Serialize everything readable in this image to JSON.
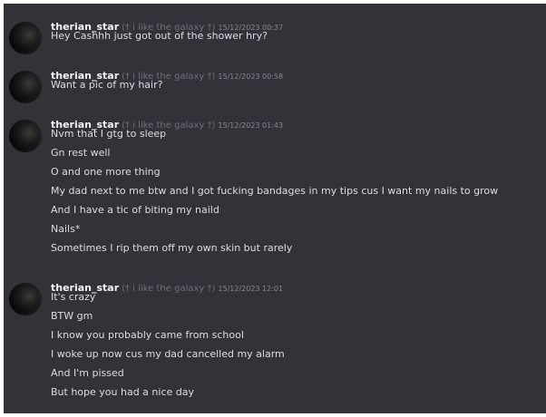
{
  "groups": [
    {
      "author": "therian_star",
      "tag": "(† i like the galaxy †)",
      "timestamp": "15/12/2023 00:37",
      "lines": [
        "Hey Cashhh just got out  of the shower hry?"
      ]
    },
    {
      "author": "therian_star",
      "tag": "(† i like the galaxy †)",
      "timestamp": "15/12/2023 00:58",
      "lines": [
        "Want a pic of my hair?"
      ]
    },
    {
      "author": "therian_star",
      "tag": "(† i like the galaxy †)",
      "timestamp": "15/12/2023 01:43",
      "lines": [
        "Nvm that I gtg to sleep",
        "Gn rest well",
        "O and one more thing",
        "My dad next to me btw and I got fucking bandages in my tips cus I want my nails to grow",
        "And I have a tic of biting my naild",
        "Nails*",
        "Sometimes I rip them off my own skin but rarely"
      ]
    },
    {
      "author": "therian_star",
      "tag": "(† i like the galaxy †)",
      "timestamp": "15/12/2023 12:01",
      "lines": [
        "It's crazy",
        "BTW gm",
        "I know you probably came from school",
        "I woke up now cus my dad cancelled my alarm",
        "And I'm pissed",
        "But hope you had a nice day"
      ]
    }
  ]
}
